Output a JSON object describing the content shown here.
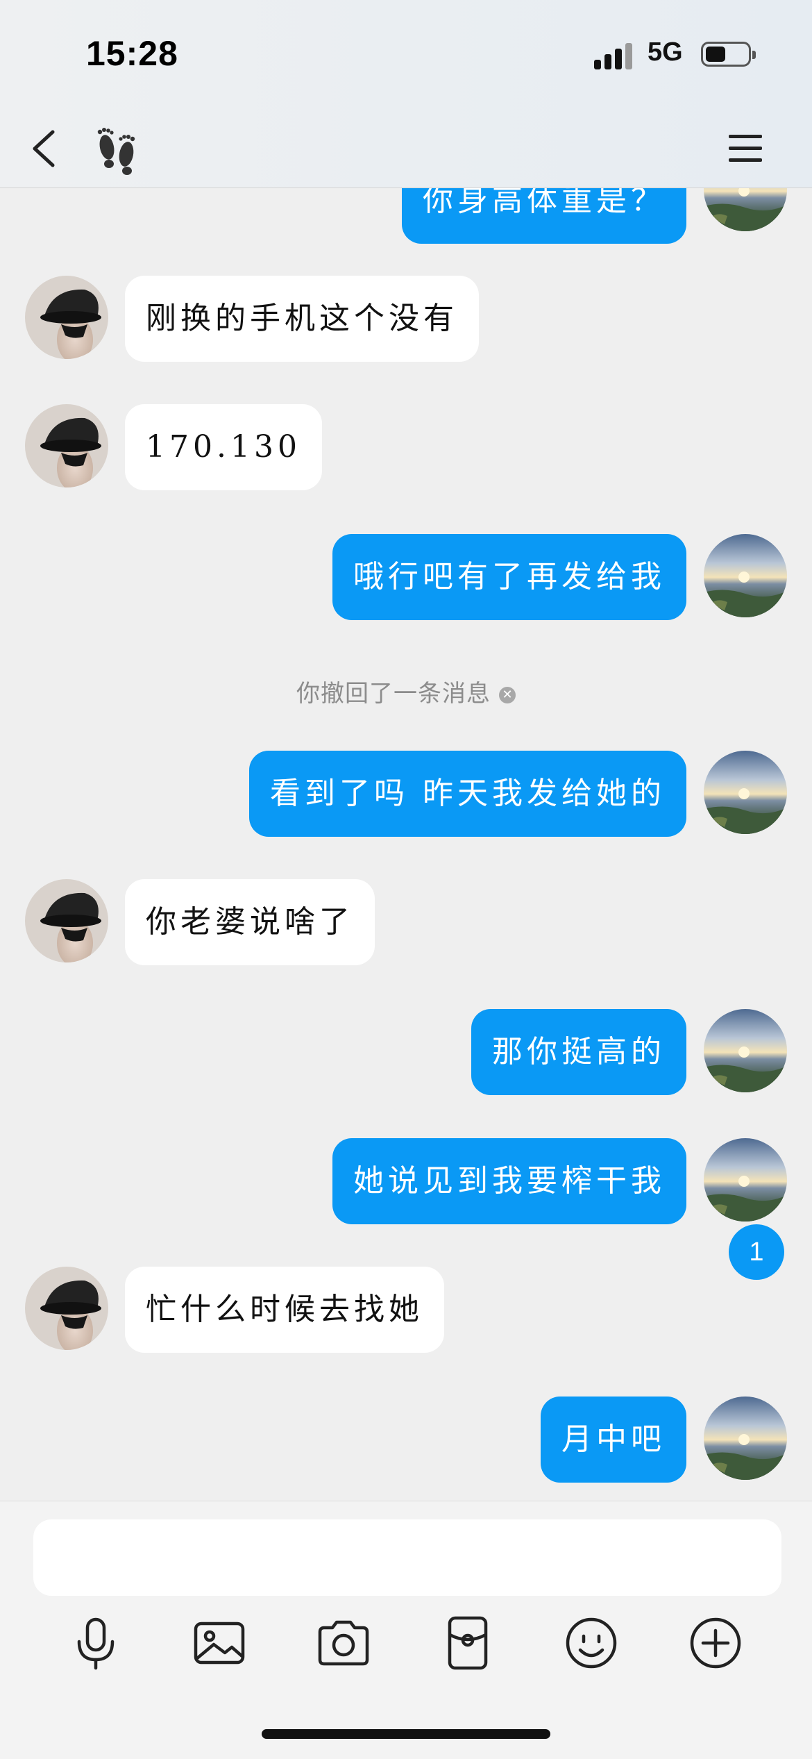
{
  "status_bar": {
    "time": "15:28",
    "network": "5G",
    "battery_level": 0.35
  },
  "nav": {
    "back_icon": "chevron-left-icon",
    "title_icon": "footprints-icon",
    "menu_icon": "hamburger-menu-icon"
  },
  "messages": [
    {
      "id": "m0",
      "side": "out",
      "text": "你身高体重是？",
      "partial": true
    },
    {
      "id": "m1",
      "side": "in",
      "text": "刚换的手机这个没有"
    },
    {
      "id": "m2",
      "side": "in",
      "text": "170.130"
    },
    {
      "id": "m3",
      "side": "out",
      "text": "哦行吧有了再发给我"
    },
    {
      "id": "m4",
      "side": "system",
      "text": "你撤回了一条消息"
    },
    {
      "id": "m5",
      "side": "out",
      "text": "看到了吗 昨天我发给她的"
    },
    {
      "id": "m6",
      "side": "in",
      "text": "你老婆说啥了"
    },
    {
      "id": "m7",
      "side": "out",
      "text": "那你挺高的"
    },
    {
      "id": "m8",
      "side": "out",
      "text": "她说见到我要榨干我"
    },
    {
      "id": "m9",
      "side": "in",
      "text": "忙什么时候去找她"
    },
    {
      "id": "m10",
      "side": "out",
      "text": "月中吧"
    }
  ],
  "unread_badge": "1",
  "input": {
    "value": "",
    "placeholder": ""
  },
  "toolbar": [
    {
      "name": "microphone-icon"
    },
    {
      "name": "image-icon"
    },
    {
      "name": "camera-icon"
    },
    {
      "name": "red-packet-icon"
    },
    {
      "name": "emoji-icon"
    },
    {
      "name": "plus-circle-icon"
    }
  ],
  "colors": {
    "outgoing_bubble": "#0a99f5",
    "incoming_bubble": "#ffffff",
    "background": "#efefef"
  }
}
